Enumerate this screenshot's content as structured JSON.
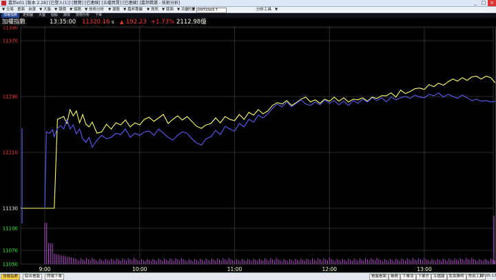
{
  "window": {
    "title": "嘉邦e01 [版本 2.28] [已登入(1)] [閱覽] [已連線] [五檔買賣] [已連線] [嘉邦精選 - 技術分析]",
    "minimize_label": "_",
    "maximize_label": "□",
    "close_label": "×"
  },
  "toolbar": {
    "items": [
      "▼",
      "交易",
      "畫面",
      "自選",
      "▼",
      "大盤",
      "▼",
      "報價",
      "▼",
      "個股",
      "▼",
      "技術分析",
      "▼",
      "選股",
      "▼",
      "嘉邦專屬",
      "▼",
      "資訊",
      "▼",
      "版面",
      "▼",
      "功能",
      "▼"
    ],
    "code_label": "代號",
    "code_value": "RMTXN06.T",
    "tool_label": "分析工具",
    "tool_caret": "▼"
  },
  "tabs": [
    {
      "label": "加權指數"
    },
    {
      "label": "走勢圖"
    },
    {
      "label": "大盤"
    },
    {
      "label": "個股"
    },
    {
      "label": "期貨"
    },
    {
      "label": "技術分析"
    },
    {
      "label": "下單"
    }
  ],
  "info": {
    "name": "加權指數",
    "time": "13:35:00",
    "price": "11320.16",
    "price_suffix": "s",
    "change_arrow": "▲",
    "change": "192.23",
    "change_pct": "+1.73%",
    "volume": "2112.98億"
  },
  "statusbar": {
    "left_buttons": [
      "加權指數",
      "綜合看盤",
      "閃電下單"
    ],
    "right_buttons": [
      "看盤看面",
      "帳務",
      "下單法",
      "下單方",
      "五檔報",
      "免責聲明",
      "常用工具"
    ],
    "clock": "13:35:13"
  },
  "colors": {
    "background": "#000000",
    "yellow_line": "#ffff66",
    "blue_line": "#5c5cf0",
    "volume": "#b14fcb",
    "axis_up": "#ff3b3b",
    "axis_down": "#33ff33",
    "grid": "#2e2e2e"
  },
  "chart_data": {
    "type": "line",
    "y_tick_labels": [
      "11390",
      "11370",
      "11290",
      "11210",
      "11130",
      "11100",
      "11070",
      "11050"
    ],
    "x_tick_labels": [
      "9:00",
      "10:00",
      "11:00",
      "12:00",
      "13:00"
    ],
    "x_ticks_min": [
      0,
      60,
      120,
      180,
      240
    ],
    "ylim": [
      11050,
      11390
    ],
    "reference": 11130,
    "session_min": [
      0,
      285
    ],
    "series": [
      {
        "color": "yellow",
        "x": [
          0,
          1,
          2,
          3,
          4,
          5,
          6,
          8,
          10,
          12,
          14,
          16,
          18,
          20,
          22,
          24,
          26,
          28,
          30,
          33,
          36,
          39,
          42,
          45,
          48,
          51,
          54,
          57,
          60,
          63,
          66,
          69,
          72,
          75,
          78,
          81,
          84,
          87,
          90,
          93,
          96,
          99,
          102,
          105,
          108,
          111,
          114,
          117,
          120,
          123,
          126,
          129,
          132,
          135,
          138,
          141,
          144,
          147,
          150,
          153,
          156,
          159,
          162,
          165,
          168,
          171,
          174,
          177,
          180,
          183,
          186,
          189,
          192,
          195,
          198,
          201,
          204,
          207,
          210,
          213,
          216,
          219,
          222,
          225,
          228,
          231,
          234,
          237,
          240,
          243,
          246,
          249,
          252,
          255,
          258,
          261,
          264,
          267,
          270,
          273,
          276,
          279,
          282,
          285
        ],
        "values": [
          11130,
          11130,
          11130,
          11130,
          11130,
          11130,
          11130,
          11258,
          11260,
          11262,
          11252,
          11272,
          11263,
          11270,
          11253,
          11265,
          11251,
          11247,
          11254,
          11238,
          11240,
          11251,
          11244,
          11253,
          11250,
          11257,
          11247,
          11253,
          11250,
          11258,
          11261,
          11255,
          11260,
          11265,
          11252,
          11258,
          11263,
          11257,
          11262,
          11255,
          11248,
          11245,
          11250,
          11252,
          11260,
          11253,
          11262,
          11258,
          11256,
          11265,
          11258,
          11268,
          11264,
          11272,
          11266,
          11270,
          11278,
          11282,
          11280,
          11285,
          11278,
          11282,
          11287,
          11290,
          11283,
          11286,
          11281,
          11287,
          11284,
          11290,
          11284,
          11289,
          11283,
          11287,
          11286,
          11289,
          11284,
          11290,
          11288,
          11292,
          11292,
          11296,
          11290,
          11300,
          11295,
          11298,
          11302,
          11303,
          11301,
          11308,
          11305,
          11310,
          11307,
          11312,
          11316,
          11313,
          11318,
          11314,
          11319,
          11320,
          11316,
          11320,
          11318,
          11310
        ]
      },
      {
        "color": "blue",
        "x": [
          0,
          1,
          3,
          5,
          6,
          8,
          10,
          12,
          14,
          16,
          18,
          20,
          22,
          24,
          26,
          28,
          30,
          33,
          36,
          39,
          42,
          45,
          48,
          51,
          54,
          57,
          60,
          63,
          66,
          69,
          72,
          75,
          78,
          81,
          84,
          87,
          90,
          93,
          96,
          99,
          102,
          105,
          108,
          111,
          114,
          117,
          120,
          123,
          126,
          129,
          132,
          135,
          138,
          141,
          144,
          147,
          150,
          153,
          156,
          159,
          162,
          165,
          168,
          171,
          174,
          177,
          180,
          183,
          186,
          189,
          192,
          195,
          198,
          201,
          204,
          207,
          210,
          213,
          216,
          219,
          222,
          225,
          228,
          231,
          234,
          237,
          240,
          243,
          246,
          249,
          252,
          255,
          258,
          261,
          264,
          267,
          270,
          273,
          276,
          279,
          282,
          285
        ],
        "values": [
          11130,
          11240,
          11238,
          11243,
          11233,
          11245,
          11249,
          11244,
          11258,
          11244,
          11250,
          11237,
          11244,
          11230,
          11225,
          11232,
          11218,
          11228,
          11235,
          11230,
          11232,
          11238,
          11236,
          11244,
          11232,
          11238,
          11235,
          11240,
          11241,
          11235,
          11244,
          11238,
          11232,
          11228,
          11235,
          11240,
          11238,
          11230,
          11224,
          11221,
          11230,
          11233,
          11242,
          11236,
          11248,
          11244,
          11241,
          11252,
          11247,
          11258,
          11254,
          11264,
          11260,
          11266,
          11274,
          11280,
          11276,
          11283,
          11276,
          11281,
          11286,
          11280,
          11278,
          11283,
          11279,
          11286,
          11281,
          11285,
          11279,
          11284,
          11278,
          11285,
          11281,
          11287,
          11283,
          11289,
          11285,
          11289,
          11283,
          11290,
          11286,
          11289,
          11291,
          11288,
          11293,
          11290,
          11289,
          11294,
          11292,
          11296,
          11290,
          11294,
          11291,
          11288,
          11293,
          11289,
          11285,
          11287,
          11284,
          11285,
          11283,
          11284
        ]
      }
    ]
  }
}
